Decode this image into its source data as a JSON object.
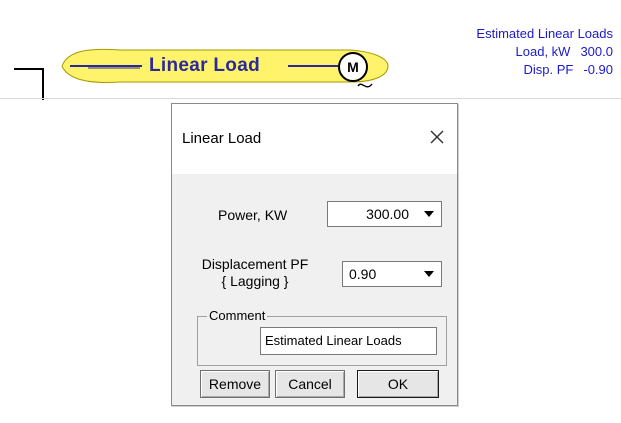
{
  "schematic": {
    "load_label": "Linear Load",
    "motor_symbol": "M",
    "estimate": {
      "title": "Estimated Linear Loads",
      "load_label": "Load, kW",
      "load_value": "300.0",
      "pf_label": "Disp. PF",
      "pf_value": "-0.90"
    },
    "colors": {
      "bar_fill": "#fff36b",
      "label": "#2a2a9a",
      "estimate_text": "#1a1acc"
    }
  },
  "dialog": {
    "title": "Linear Load",
    "close_icon": "close-icon",
    "power": {
      "label": "Power, KW",
      "value": "300.00"
    },
    "pf": {
      "label_line1": "Displacement PF",
      "label_line2": "{ Lagging }",
      "value": "0.90"
    },
    "comment": {
      "legend": "Comment",
      "value": "Estimated Linear Loads"
    },
    "buttons": {
      "remove": "Remove",
      "cancel": "Cancel",
      "ok": "OK"
    }
  }
}
